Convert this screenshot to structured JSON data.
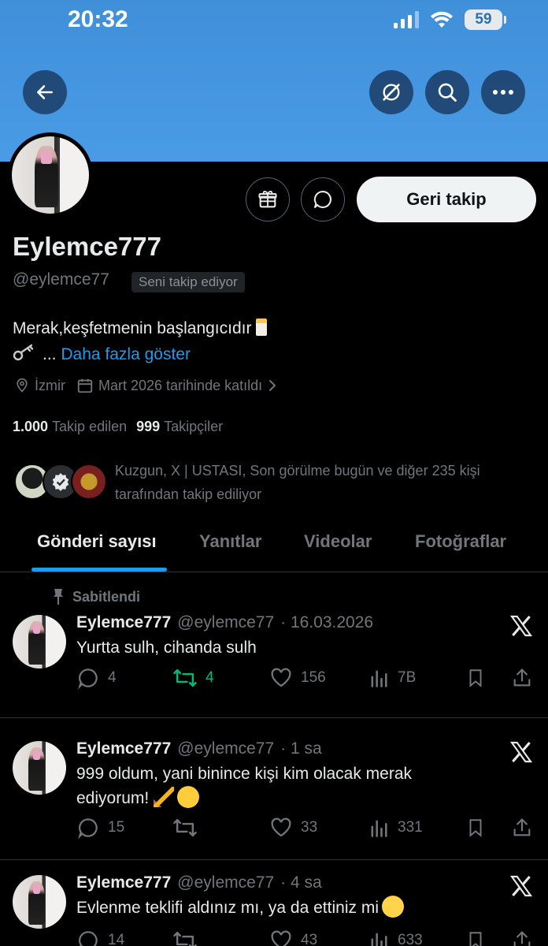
{
  "status_bar": {
    "time": "20:32",
    "battery": "59"
  },
  "profile": {
    "display_name": "Eylemce777",
    "handle": "@eylemce77",
    "follows_you": "Seni takip ediyor",
    "follow_back_label": "Geri takip",
    "bio_line1": "Merak,keşfetmenin başlangıcıdır",
    "bio_ellipsis": "...",
    "bio_more": "Daha fazla göster",
    "location": "İzmir",
    "joined": "Mart 2026 tarihinde katıldı",
    "following_count": "1.000",
    "following_label": "Takip edilen",
    "followers_count": "999",
    "followers_label": "Takipçiler",
    "followed_by": "Kuzgun, X | USTASI, Son görülme bugün ve diğer 235 kişi tarafından takip ediliyor"
  },
  "tabs": [
    {
      "label": "Gönderi sayısı",
      "active": true
    },
    {
      "label": "Yanıtlar",
      "active": false
    },
    {
      "label": "Videolar",
      "active": false
    },
    {
      "label": "Fotoğraflar",
      "active": false
    }
  ],
  "pinned_label": "Sabitlendi",
  "posts": [
    {
      "name": "Eylemce777",
      "handle": "@eylemce77",
      "time": "· 16.03.2026",
      "text": "Yurtta sulh, cihanda sulh",
      "replies": "4",
      "reposts": "4",
      "likes": "156",
      "views": "7B"
    },
    {
      "name": "Eylemce777",
      "handle": "@eylemce77",
      "time": "· 1 sa",
      "text": "999 oldum, yani binince kişi kim olacak merak ediyorum!",
      "replies": "15",
      "reposts": "",
      "likes": "33",
      "views": "331"
    },
    {
      "name": "Eylemce777",
      "handle": "@eylemce77",
      "time": "· 4 sa",
      "text": "Evlenme teklifi aldınız mı, ya da ettiniz mi",
      "replies": "14",
      "reposts": "",
      "likes": "43",
      "views": "633"
    }
  ],
  "colors": {
    "accent": "#1d9bf0",
    "repost_active": "#00ba7c",
    "banner": "#4a9be6"
  }
}
